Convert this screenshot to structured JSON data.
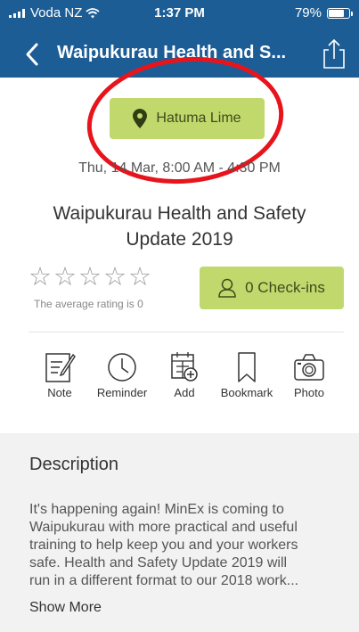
{
  "status_bar": {
    "carrier": "Voda NZ",
    "time": "1:37 PM",
    "battery": "79%",
    "battery_level": 0.79
  },
  "nav": {
    "title": "Waipukurau Health and S..."
  },
  "location": {
    "name": "Hatuma Lime"
  },
  "event": {
    "date": "Thu, 14 Mar, 8:00 AM - 4:30 PM",
    "title": "Waipukurau Health and Safety Update 2019"
  },
  "rating": {
    "stars_filled": 0,
    "stars_total": 5,
    "caption": "The average rating is 0"
  },
  "checkins": {
    "label": "0 Check-ins"
  },
  "actions": [
    {
      "label": "Note",
      "icon": "note-icon"
    },
    {
      "label": "Reminder",
      "icon": "clock-icon"
    },
    {
      "label": "Add",
      "icon": "calendar-add-icon"
    },
    {
      "label": "Bookmark",
      "icon": "bookmark-icon"
    },
    {
      "label": "Photo",
      "icon": "camera-icon"
    }
  ],
  "description": {
    "heading": "Description",
    "body_lines": [
      "It's happening again! MinEx is coming to",
      "Waipukurau with more practical and useful",
      "training to help keep you and your workers",
      "safe. Health and Safety Update 2019 will",
      "run in a different format to our 2018 work..."
    ],
    "show_more": "Show More"
  },
  "colors": {
    "header": "#1d5d96",
    "accent_green": "#c1d86d",
    "annotation_red": "#e8141c"
  }
}
